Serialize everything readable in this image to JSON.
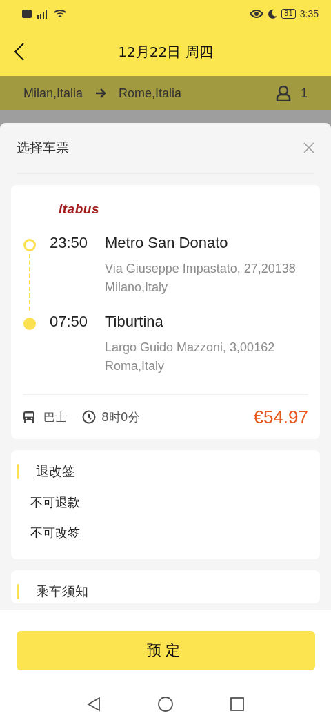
{
  "status_bar": {
    "battery": "81",
    "time": "3:35"
  },
  "header": {
    "title": "12月22日 周四"
  },
  "route": {
    "from": "Milan,Italia",
    "to": "Rome,Italia",
    "passengers": "1"
  },
  "sheet": {
    "title": "选择车票"
  },
  "ticket": {
    "operator": "itabus",
    "stops": [
      {
        "kind": "departure",
        "time": "23:50",
        "name": "Metro San Donato",
        "address": "Via Giuseppe Impastato, 27,20138 Milano,Italy"
      },
      {
        "kind": "arrival",
        "time": "07:50",
        "name": "Tiburtina",
        "address": "Largo Guido Mazzoni, 3,00162 Roma,Italy"
      }
    ],
    "vehicle": "巴士",
    "duration": "8时0分",
    "price": "€54.97"
  },
  "sections": [
    {
      "title": "退改签",
      "lines": [
        "不可退款",
        "不可改签"
      ]
    },
    {
      "title": "乘车须知"
    }
  ],
  "book_button": "预定"
}
